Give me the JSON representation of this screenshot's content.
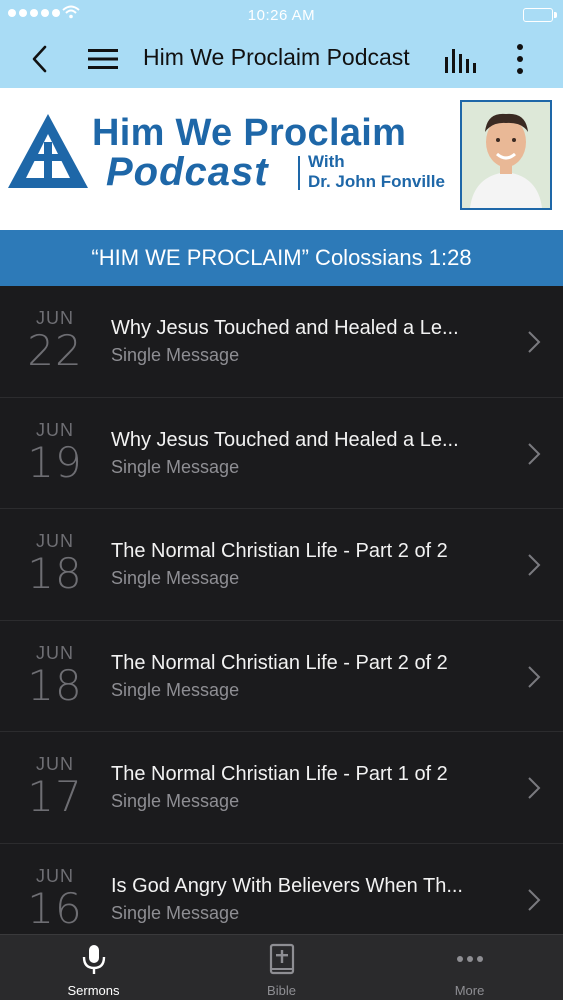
{
  "status_bar": {
    "time": "10:26 AM"
  },
  "nav": {
    "title": "Him We Proclaim Podcast"
  },
  "banner": {
    "logo_title": "Him We Proclaim",
    "logo_subtitle": "Podcast",
    "logo_with": "With",
    "logo_host": "Dr. John Fonville"
  },
  "series": {
    "label": "“HIM WE PROCLAIM” Colossians 1:28"
  },
  "sermons": [
    {
      "month": "JUN",
      "day": "22",
      "title": "Why Jesus Touched and Healed a Le...",
      "subtitle": "Single Message"
    },
    {
      "month": "JUN",
      "day": "19",
      "title": "Why Jesus Touched and Healed a Le...",
      "subtitle": "Single Message"
    },
    {
      "month": "JUN",
      "day": "18",
      "title": "The Normal Christian Life - Part 2 of 2",
      "subtitle": "Single Message"
    },
    {
      "month": "JUN",
      "day": "18",
      "title": "The Normal Christian Life - Part 2 of 2",
      "subtitle": "Single Message"
    },
    {
      "month": "JUN",
      "day": "17",
      "title": "The Normal Christian Life - Part 1 of 2",
      "subtitle": "Single Message"
    },
    {
      "month": "JUN",
      "day": "16",
      "title": "Is God Angry With Believers When Th...",
      "subtitle": "Single Message"
    }
  ],
  "tabs": [
    {
      "label": "Sermons",
      "icon": "microphone-icon",
      "active": true
    },
    {
      "label": "Bible",
      "icon": "bible-icon",
      "active": false
    },
    {
      "label": "More",
      "icon": "more-icon",
      "active": false
    }
  ],
  "colors": {
    "nav_bg": "#a9dcf5",
    "series_bar": "#2d7ab8",
    "logo_blue": "#1e67a8",
    "list_bg": "#1b1b1d",
    "tabbar_bg": "#2a2a2c"
  }
}
